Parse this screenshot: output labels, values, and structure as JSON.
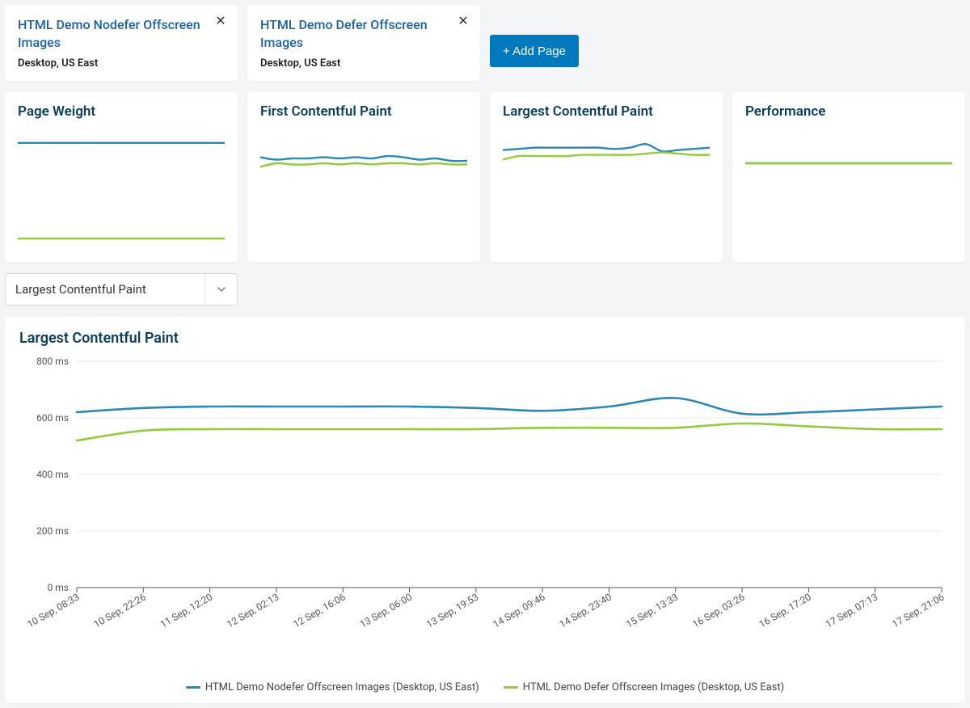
{
  "colors": {
    "blue": "#2a88b5",
    "green": "#94ca3d",
    "accent": "#0079be",
    "heading": "#0b3d5c",
    "link": "#1a62a6"
  },
  "pages": [
    {
      "title": "HTML Demo Nodefer Offscreen Images",
      "subtitle": "Desktop, US East"
    },
    {
      "title": "HTML Demo Defer Offscreen Images",
      "subtitle": "Desktop, US East"
    }
  ],
  "add_page_label": "+ Add Page",
  "mini_charts": [
    {
      "title": "Page Weight"
    },
    {
      "title": "First Contentful Paint"
    },
    {
      "title": "Largest Contentful Paint"
    },
    {
      "title": "Performance"
    }
  ],
  "dropdown_selected": "Largest Contentful Paint",
  "main_chart_title": "Largest Contentful Paint",
  "legend": [
    "HTML Demo Nodefer Offscreen Images (Desktop, US East)",
    "HTML Demo Defer Offscreen Images (Desktop, US East)"
  ],
  "chart_data": {
    "main": {
      "type": "line",
      "title": "Largest Contentful Paint",
      "xlabel": "",
      "ylabel": "",
      "ylim": [
        0,
        800
      ],
      "yticks": [
        0,
        200,
        400,
        600,
        800
      ],
      "yunit": "ms",
      "x": [
        "10 Sep, 08:33",
        "10 Sep, 22:26",
        "11 Sep, 12:20",
        "12 Sep, 02:13",
        "12 Sep, 16:06",
        "13 Sep, 06:00",
        "13 Sep, 19:53",
        "14 Sep, 09:46",
        "14 Sep, 23:40",
        "15 Sep, 13:33",
        "16 Sep, 03:26",
        "16 Sep, 17:20",
        "17 Sep, 07:13",
        "17 Sep, 21:06"
      ],
      "series": [
        {
          "name": "HTML Demo Nodefer Offscreen Images (Desktop, US East)",
          "color": "blue",
          "values": [
            620,
            635,
            640,
            640,
            640,
            640,
            635,
            625,
            640,
            670,
            615,
            620,
            630,
            640
          ]
        },
        {
          "name": "HTML Demo Defer Offscreen Images (Desktop, US East)",
          "color": "green",
          "values": [
            520,
            555,
            560,
            560,
            560,
            560,
            560,
            565,
            565,
            565,
            580,
            570,
            560,
            560
          ]
        }
      ]
    },
    "mini": [
      {
        "id": "page_weight",
        "type": "line",
        "ylim": [
          0,
          100
        ],
        "series": [
          {
            "color": "blue",
            "values": [
              90,
              90,
              90,
              90,
              90,
              90,
              90,
              90,
              90,
              90,
              90,
              90,
              90,
              90
            ]
          },
          {
            "color": "green",
            "values": [
              10,
              10,
              10,
              10,
              10,
              10,
              10,
              10,
              10,
              10,
              10,
              10,
              10,
              10
            ]
          }
        ]
      },
      {
        "id": "fcp",
        "type": "line",
        "ylim": [
          0,
          100
        ],
        "series": [
          {
            "color": "blue",
            "values": [
              78,
              76,
              77,
              77,
              78,
              77,
              78,
              77,
              79,
              78,
              76,
              77,
              75,
              75
            ]
          },
          {
            "color": "green",
            "values": [
              70,
              73,
              72,
              72,
              73,
              72,
              73,
              72,
              73,
              73,
              72,
              73,
              72,
              72
            ]
          }
        ]
      },
      {
        "id": "lcp",
        "type": "line",
        "ylim": [
          0,
          100
        ],
        "series": [
          {
            "color": "blue",
            "values": [
              84,
              85,
              86,
              86,
              86,
              86,
              86,
              85,
              86,
              89,
              83,
              84,
              85,
              86
            ]
          },
          {
            "color": "green",
            "values": [
              76,
              79,
              79,
              79,
              79,
              80,
              80,
              80,
              80,
              81,
              82,
              81,
              80,
              80
            ]
          }
        ]
      },
      {
        "id": "performance",
        "type": "line",
        "ylim": [
          0,
          100
        ],
        "series": [
          {
            "color": "blue",
            "values": [
              73,
              73,
              73,
              73,
              73,
              73,
              73,
              73,
              73,
              73,
              73,
              73,
              73,
              73
            ]
          },
          {
            "color": "green",
            "values": [
              73,
              73,
              73,
              73,
              73,
              73,
              73,
              73,
              73,
              73,
              73,
              73,
              73,
              73
            ]
          }
        ]
      }
    ]
  }
}
